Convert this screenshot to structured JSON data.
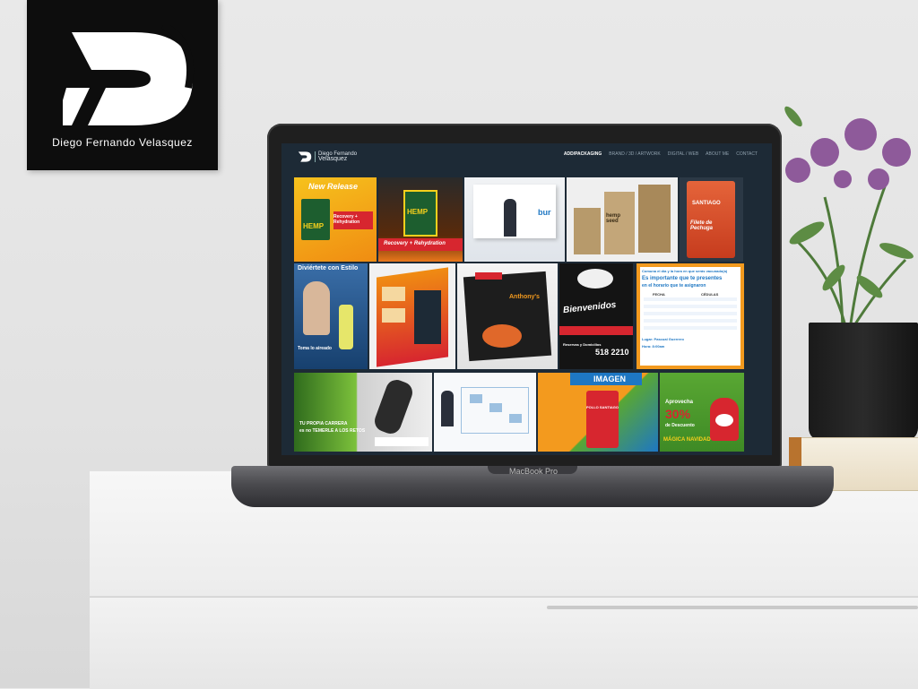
{
  "logo": {
    "name": "Diego Fernando Velasquez"
  },
  "laptop": {
    "brand": "MacBook Pro"
  },
  "site": {
    "logo_line1": "Diego Fernando",
    "logo_line2": "Velasquez",
    "nav": [
      "ADD/PACKAGING",
      "BRAND / 3D / ARTWORK",
      "DIGITAL / WEB",
      "ABOUT ME",
      "CONTACT"
    ],
    "active_nav": "ADD/PACKAGING"
  },
  "tiles": {
    "t1_title": "New Release",
    "t1_brand": "HEMP",
    "t1_sub": "Recovery + Rehydration",
    "t2_brand": "HEMP",
    "t2_sub": "Recovery + Rehydration",
    "t3_brand": "bur",
    "t4_brand": "hemp seed",
    "t5_brand": "SANTIAGO",
    "t5_sub": "Filete de Pechuga",
    "t6_title": "Diviértete con Estilo",
    "t6_sub": "Toma lo aireado",
    "t7_title": "Anthony's",
    "t9_title": "Bienvenidos",
    "t9_sub": "Reservas y Domicilios",
    "t9_phone": "518 2210",
    "t10_head": "Es importante que te presentes",
    "t10_top": "Comuna el día y la hora en que serás vacunado(a)",
    "t10_sub": "en el horario que te asignaron",
    "t10_label1": "FECHA",
    "t10_label2": "CÉDULAS",
    "t10_place": "Lugar: Pascual Guerrero",
    "t10_time": "Hora: 8:00am",
    "t11_line1": "TU PROPIA CARRERA",
    "t11_line2": "es no TEMERLE A LOS RETOS",
    "t13_head": "IMAGEN",
    "t13_brand": "POLLO SANTIAGO",
    "t14_head": "Aprovecha",
    "t14_pct": "30%",
    "t14_sub": "de Descuento",
    "t14_foot": "MÁGICA NAVIDAD"
  },
  "colors": {
    "screen_bg": "#1d2a36",
    "accent_orange": "#f39a1e",
    "accent_red": "#d7262f",
    "accent_green": "#59a733",
    "accent_blue": "#1e77c3"
  },
  "icons": [
    "df-logo-icon",
    "flower-icon"
  ]
}
